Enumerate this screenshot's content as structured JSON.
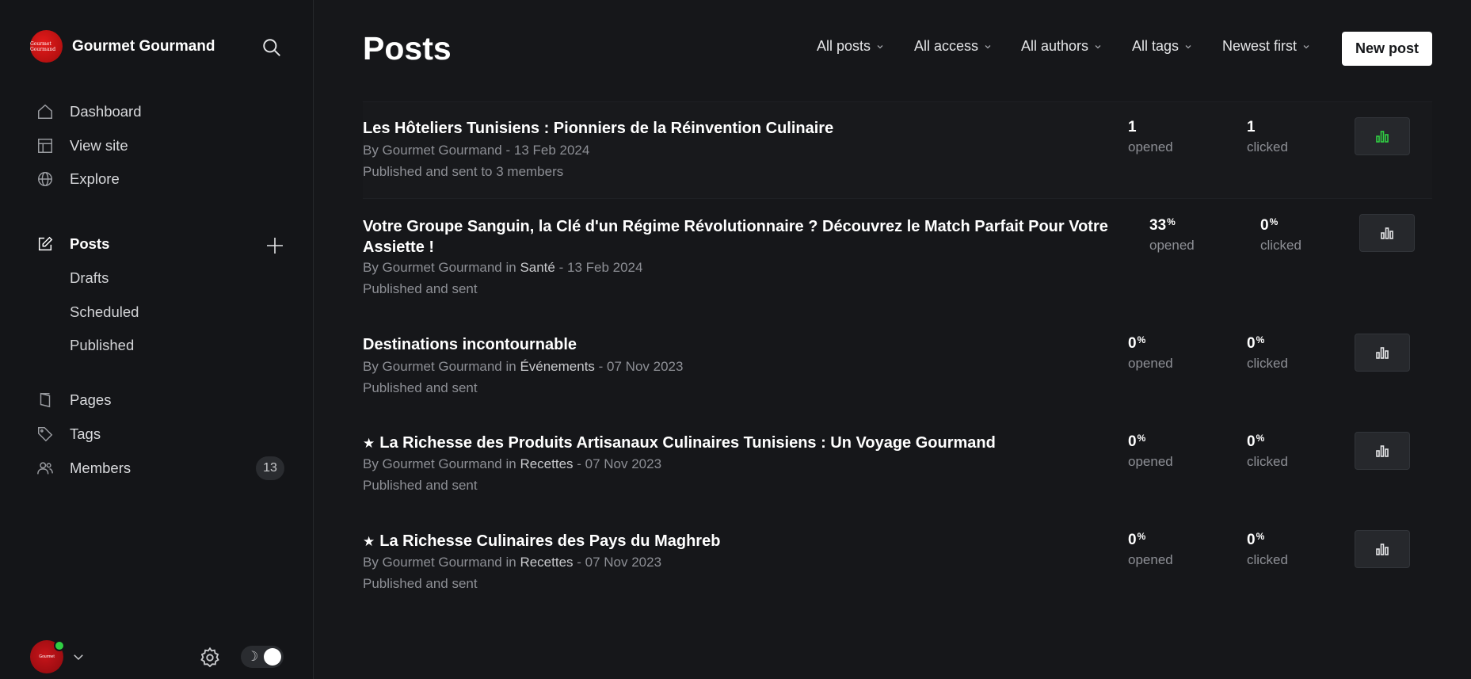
{
  "sidebar": {
    "brand": {
      "name": "Gourmet Gourmand",
      "logo_text": "Gourmet Gourmand"
    },
    "nav": {
      "dashboard": "Dashboard",
      "view_site": "View site",
      "explore": "Explore",
      "posts": "Posts",
      "drafts": "Drafts",
      "scheduled": "Scheduled",
      "published": "Published",
      "pages": "Pages",
      "tags": "Tags",
      "members": "Members",
      "members_count": "13"
    },
    "avatar_text": "Gourmet"
  },
  "header": {
    "title": "Posts",
    "filters": [
      "All posts",
      "All access",
      "All authors",
      "All tags",
      "Newest first"
    ],
    "new_post_label": "New post"
  },
  "posts": [
    {
      "title": "Les Hôteliers Tunisiens : Pionniers de la Réinvention Culinaire",
      "featured": false,
      "meta_prefix": "By Gourmet Gourmand",
      "tag": "",
      "date": "13 Feb 2024",
      "status": "Published and sent to 3 members",
      "opened": "1",
      "opened_pct": "",
      "clicked": "1",
      "clicked_pct": "",
      "opened_label": "opened",
      "clicked_label": "clicked"
    },
    {
      "title": "Votre Groupe Sanguin, la Clé d'un Régime Révolutionnaire ? Découvrez le Match Parfait Pour Votre Assiette !",
      "featured": false,
      "meta_prefix": "By Gourmet Gourmand in",
      "tag": "Santé",
      "date": "13 Feb 2024",
      "status": "Published and sent",
      "opened": "33",
      "opened_pct": "%",
      "clicked": "0",
      "clicked_pct": "%",
      "opened_label": "opened",
      "clicked_label": "clicked"
    },
    {
      "title": "Destinations incontournable",
      "featured": false,
      "meta_prefix": "By Gourmet Gourmand in",
      "tag": "Événements",
      "date": "07 Nov 2023",
      "status": "Published and sent",
      "opened": "0",
      "opened_pct": "%",
      "clicked": "0",
      "clicked_pct": "%",
      "opened_label": "opened",
      "clicked_label": "clicked"
    },
    {
      "title": "La Richesse des Produits Artisanaux Culinaires Tunisiens : Un Voyage Gourmand",
      "featured": true,
      "meta_prefix": "By Gourmet Gourmand in",
      "tag": "Recettes",
      "date": "07 Nov 2023",
      "status": "Published and sent",
      "opened": "0",
      "opened_pct": "%",
      "clicked": "0",
      "clicked_pct": "%",
      "opened_label": "opened",
      "clicked_label": "clicked"
    },
    {
      "title": "La Richesse Culinaires des Pays du Maghreb",
      "featured": true,
      "meta_prefix": "By Gourmet Gourmand in",
      "tag": "Recettes",
      "date": "07 Nov 2023",
      "status": "Published and sent",
      "opened": "0",
      "opened_pct": "%",
      "clicked": "0",
      "clicked_pct": "%",
      "opened_label": "opened",
      "clicked_label": "clicked"
    }
  ],
  "icons": {
    "star": "★",
    "moon": "☽"
  },
  "colors": {
    "background": "#16171a",
    "sidebar": "#141518",
    "accent_green": "#30cf43",
    "brand_red": "#d3141a"
  }
}
